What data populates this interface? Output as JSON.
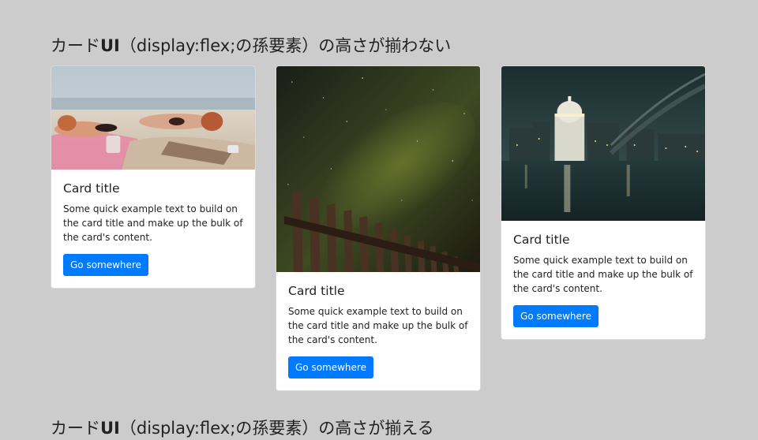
{
  "headings": [
    {
      "pre": "カード",
      "strong": "UI",
      "post": "（display:flex;の孫要素）の高さが揃わない"
    },
    {
      "pre": "カード",
      "strong": "UI",
      "post": "（display:flex;の孫要素）の高さが揃える"
    }
  ],
  "cards": [
    {
      "image_alt": "people sunbathing on a beach",
      "title": "Card title",
      "text": "Some quick example text to build on the card title and make up the bulk of the card's content.",
      "button_label": "Go somewhere"
    },
    {
      "image_alt": "starry night sky over a wooden fence",
      "title": "Card title",
      "text": "Some quick example text to build on the card title and make up the bulk of the card's content.",
      "button_label": "Go somewhere"
    },
    {
      "image_alt": "city skyline with domed cathedral at night by a river",
      "title": "Card title",
      "text": "Some quick example text to build on the card title and make up the bulk of the card's content.",
      "button_label": "Go somewhere"
    }
  ],
  "colors": {
    "page_background": "#cccccc",
    "card_background": "#ffffff",
    "button": "#007bff",
    "button_text": "#ffffff"
  }
}
